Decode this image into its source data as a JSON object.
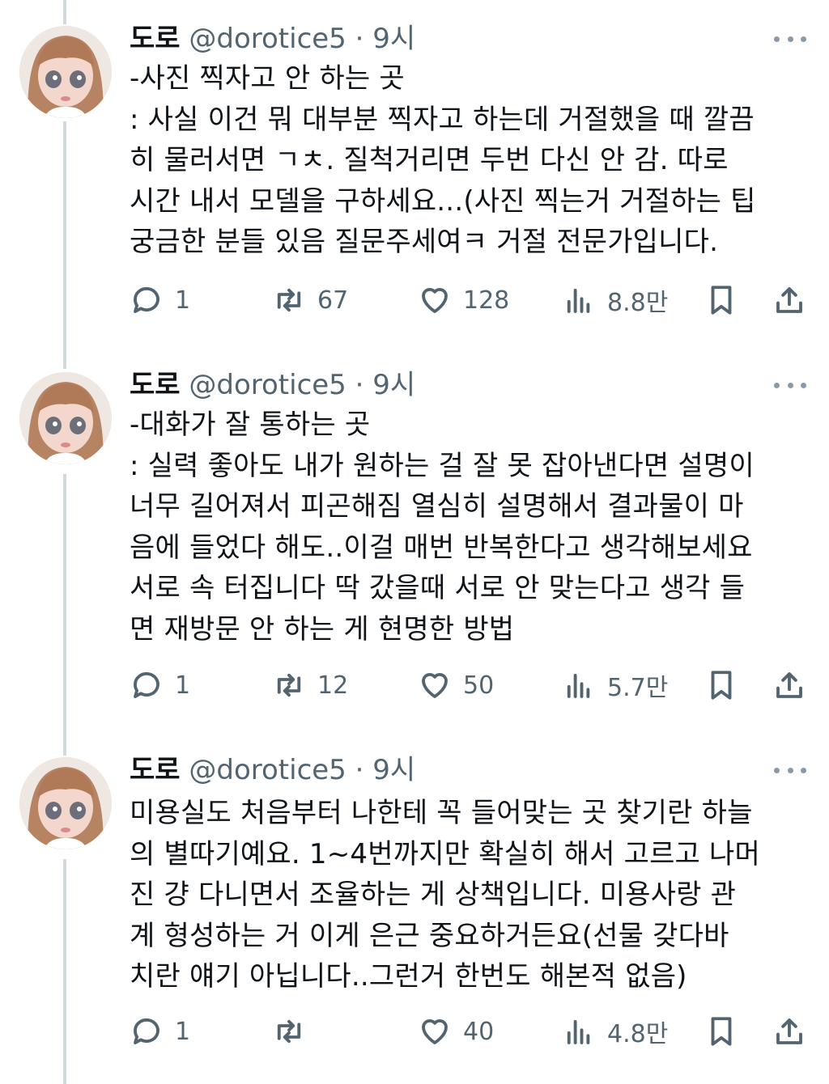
{
  "tweets": [
    {
      "name": "도로",
      "handle": "@dorotice5",
      "time": "· 9시",
      "text": "-사진 찍자고 안 하는 곳\n: 사실 이건 뭐 대부분 찍자고 하는데 거절했을 때 깔끔\n히 물러서면 ㄱㅊ. 질척거리면 두번 다신 안 감. 따로\n시간 내서 모델을 구하세요...(사진 찍는거 거절하는 팁\n궁금한 분들 있음 질문주세여ㅋ 거절 전문가입니다.",
      "replies": "1",
      "retweets": "67",
      "likes": "128",
      "views": "8.8만"
    },
    {
      "name": "도로",
      "handle": "@dorotice5",
      "time": "· 9시",
      "text": "-대화가 잘 통하는 곳\n: 실력 좋아도 내가 원하는 걸 잘 못 잡아낸다면 설명이\n너무 길어져서 피곤해짐 열심히 설명해서 결과물이 마\n음에 들었다 해도..이걸 매번 반복한다고 생각해보세요\n서로 속 터집니다 딱 갔을때 서로 안 맞는다고 생각 들\n면 재방문 안 하는 게 현명한 방법",
      "replies": "1",
      "retweets": "12",
      "likes": "50",
      "views": "5.7만"
    },
    {
      "name": "도로",
      "handle": "@dorotice5",
      "time": "· 9시",
      "text": "미용실도 처음부터 나한테 꼭 들어맞는 곳 찾기란 하늘\n의 별따기예요. 1~4번까지만 확실히 해서 고르고 나머\n진 걍 다니면서 조율하는 게 상책입니다. 미용사랑 관\n계 형성하는 거 이게 은근 중요하거든요(선물 갖다바\n치란 얘기 아닙니다..그런거 한번도 해본적 없음)",
      "replies": "1",
      "retweets": "",
      "likes": "40",
      "views": "4.8만"
    }
  ],
  "icons": {
    "reply": "reply-icon",
    "retweet": "retweet-icon",
    "like": "heart-icon",
    "views": "views-icon",
    "bookmark": "bookmark-icon",
    "share": "share-icon",
    "more": "more-icon"
  },
  "colors": {
    "text": "#0f1419",
    "secondary": "#536471",
    "thread_line": "#cfd9de"
  }
}
